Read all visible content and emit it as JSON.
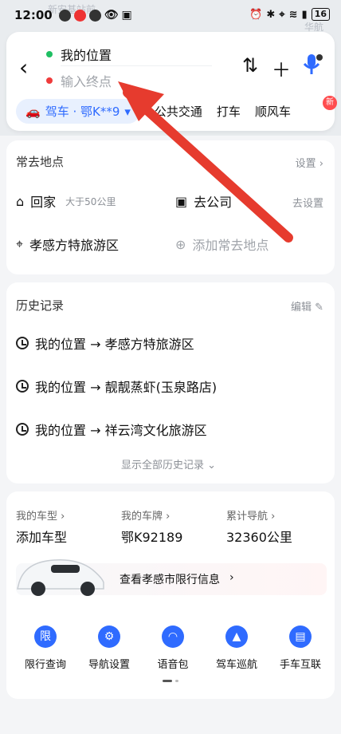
{
  "status": {
    "time": "12:00",
    "battery": "16"
  },
  "map": {
    "label1": "新安基站前",
    "label2": "华航"
  },
  "search": {
    "my_location": "我的位置",
    "end_placeholder": "输入终点"
  },
  "tabs": {
    "drive": "驾车 · 鄂K**9",
    "bus": "公共交通",
    "taxi": "打车",
    "ride": "顺风车",
    "new_badge": "新"
  },
  "frequent": {
    "title": "常去地点",
    "action": "设置",
    "home": "回家",
    "home_note": "大于50公里",
    "company": "去公司",
    "company_action": "去设置",
    "place": "孝感方特旅游区",
    "add": "添加常去地点"
  },
  "history": {
    "title": "历史记录",
    "action": "编辑",
    "items": [
      "我的位置 → 孝感方特旅游区",
      "我的位置 → 靓靓蒸虾(玉泉路店)",
      "我的位置 → 祥云湾文化旅游区"
    ],
    "show_all": "显示全部历史记录"
  },
  "vehicle": {
    "model_label": "我的车型",
    "model_value": "添加车型",
    "plate_label": "我的车牌",
    "plate_value": "鄂K92189",
    "nav_label": "累计导航",
    "nav_value": "32360公里",
    "restriction": "查看孝感市限行信息"
  },
  "quick": [
    "限行查询",
    "导航设置",
    "语音包",
    "驾车巡航",
    "手车互联"
  ],
  "colors": {
    "accent": "#2f6bff",
    "arrow": "#e63b2e",
    "green": "#1fbf63",
    "red": "#ef3b3b"
  }
}
